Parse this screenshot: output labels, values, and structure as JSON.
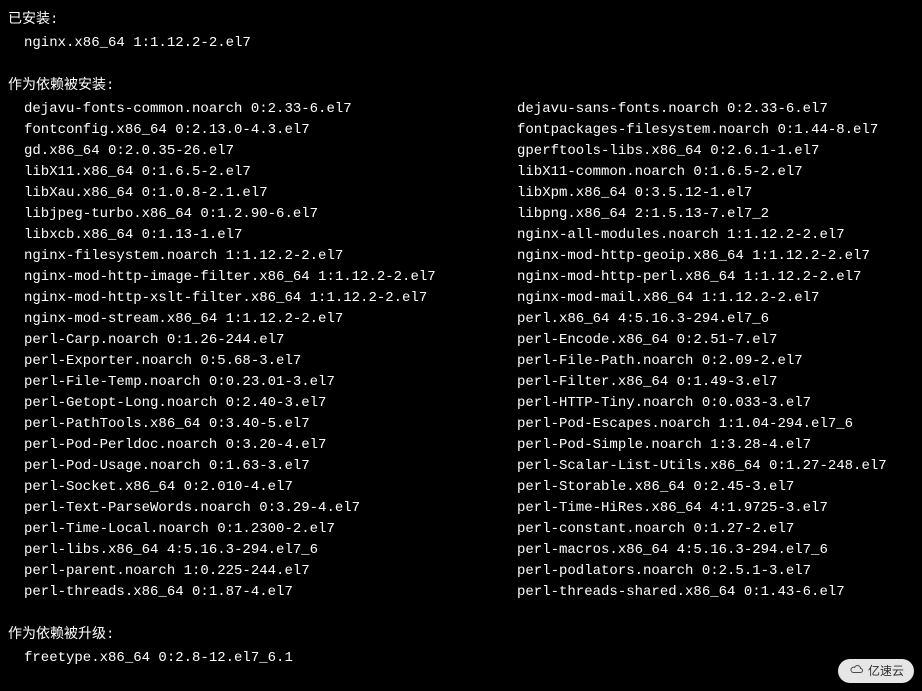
{
  "sections": {
    "installed_header": "已安装:",
    "installed_pkg": "nginx.x86_64 1:1.12.2-2.el7",
    "deps_installed_header": "作为依赖被安装:",
    "deps_upgraded_header": "作为依赖被升级:",
    "upgraded_pkg": "freetype.x86_64 0:2.8-12.el7_6.1"
  },
  "deps_left": [
    "dejavu-fonts-common.noarch 0:2.33-6.el7",
    "fontconfig.x86_64 0:2.13.0-4.3.el7",
    "gd.x86_64 0:2.0.35-26.el7",
    "libX11.x86_64 0:1.6.5-2.el7",
    "libXau.x86_64 0:1.0.8-2.1.el7",
    "libjpeg-turbo.x86_64 0:1.2.90-6.el7",
    "libxcb.x86_64 0:1.13-1.el7",
    "nginx-filesystem.noarch 1:1.12.2-2.el7",
    "nginx-mod-http-image-filter.x86_64 1:1.12.2-2.el7",
    "nginx-mod-http-xslt-filter.x86_64 1:1.12.2-2.el7",
    "nginx-mod-stream.x86_64 1:1.12.2-2.el7",
    "perl-Carp.noarch 0:1.26-244.el7",
    "perl-Exporter.noarch 0:5.68-3.el7",
    "perl-File-Temp.noarch 0:0.23.01-3.el7",
    "perl-Getopt-Long.noarch 0:2.40-3.el7",
    "perl-PathTools.x86_64 0:3.40-5.el7",
    "perl-Pod-Perldoc.noarch 0:3.20-4.el7",
    "perl-Pod-Usage.noarch 0:1.63-3.el7",
    "perl-Socket.x86_64 0:2.010-4.el7",
    "perl-Text-ParseWords.noarch 0:3.29-4.el7",
    "perl-Time-Local.noarch 0:1.2300-2.el7",
    "perl-libs.x86_64 4:5.16.3-294.el7_6",
    "perl-parent.noarch 1:0.225-244.el7",
    "perl-threads.x86_64 0:1.87-4.el7"
  ],
  "deps_right": [
    "dejavu-sans-fonts.noarch 0:2.33-6.el7",
    "fontpackages-filesystem.noarch 0:1.44-8.el7",
    "gperftools-libs.x86_64 0:2.6.1-1.el7",
    "libX11-common.noarch 0:1.6.5-2.el7",
    "libXpm.x86_64 0:3.5.12-1.el7",
    "libpng.x86_64 2:1.5.13-7.el7_2",
    "nginx-all-modules.noarch 1:1.12.2-2.el7",
    "nginx-mod-http-geoip.x86_64 1:1.12.2-2.el7",
    "nginx-mod-http-perl.x86_64 1:1.12.2-2.el7",
    "nginx-mod-mail.x86_64 1:1.12.2-2.el7",
    "perl.x86_64 4:5.16.3-294.el7_6",
    "perl-Encode.x86_64 0:2.51-7.el7",
    "perl-File-Path.noarch 0:2.09-2.el7",
    "perl-Filter.x86_64 0:1.49-3.el7",
    "perl-HTTP-Tiny.noarch 0:0.033-3.el7",
    "perl-Pod-Escapes.noarch 1:1.04-294.el7_6",
    "perl-Pod-Simple.noarch 1:3.28-4.el7",
    "perl-Scalar-List-Utils.x86_64 0:1.27-248.el7",
    "perl-Storable.x86_64 0:2.45-3.el7",
    "perl-Time-HiRes.x86_64 4:1.9725-3.el7",
    "perl-constant.noarch 0:1.27-2.el7",
    "perl-macros.x86_64 4:5.16.3-294.el7_6",
    "perl-podlators.noarch 0:2.5.1-3.el7",
    "perl-threads-shared.x86_64 0:1.43-6.el7"
  ],
  "watermark": {
    "text": "亿速云"
  }
}
